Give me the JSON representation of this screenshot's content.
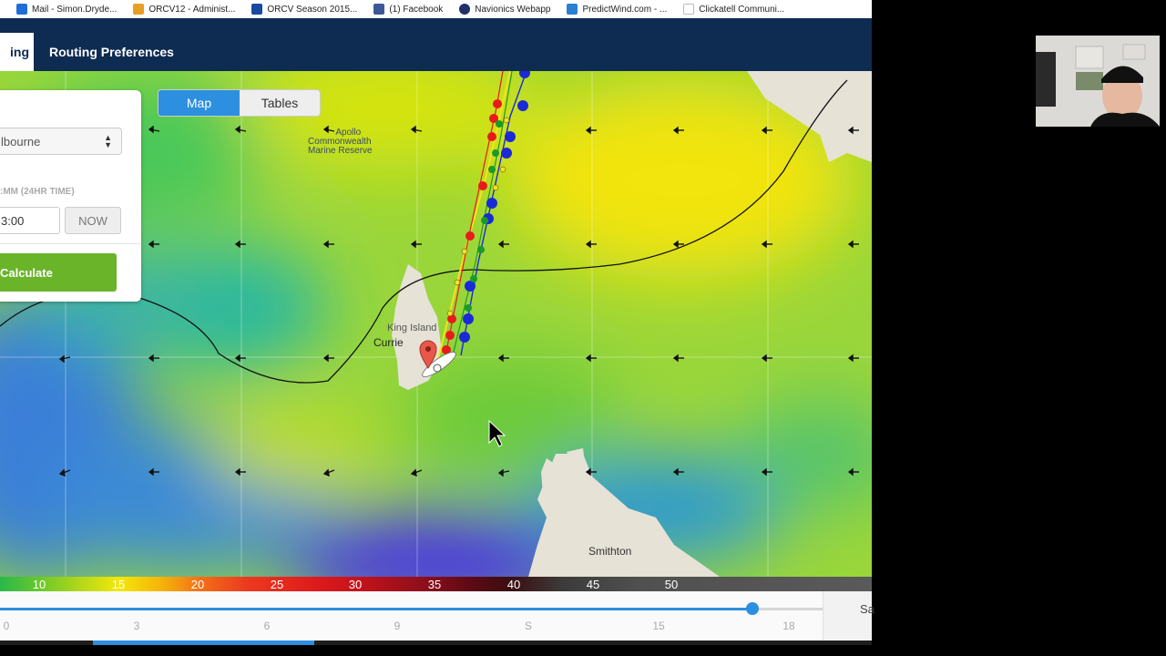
{
  "bookmarks": [
    {
      "label": "Mail - Simon.Dryde...",
      "color": "#1f6fd6"
    },
    {
      "label": "ORCV12 - Administ...",
      "color": "#e8a020"
    },
    {
      "label": "ORCV Season 2015...",
      "color": "#1a4aa0"
    },
    {
      "label": "(1) Facebook",
      "color": "#3b5998"
    },
    {
      "label": "Navionics Webapp",
      "color": "#20306a"
    },
    {
      "label": "PredictWind.com - ...",
      "color": "#2a7fd0"
    },
    {
      "label": "Clickatell Communi...",
      "color": "#e94040"
    }
  ],
  "nav": {
    "active_tab": "ing",
    "routing_preferences": "Routing Preferences"
  },
  "map_toggle": {
    "map": "Map",
    "tables": "Tables"
  },
  "panel": {
    "destination_value": "lbourne",
    "time_label": ":MM (24HR TIME)",
    "time_value": "3:00",
    "now_label": "NOW",
    "calculate_label": "Calculate"
  },
  "map_labels": {
    "reserve_line1": "Apollo",
    "reserve_line2": "Commonwealth",
    "reserve_line3": "Marine Reserve",
    "king_island": "King Island",
    "currie": "Currie",
    "smithton": "Smithton"
  },
  "scale_ticks": [
    "10",
    "15",
    "20",
    "25",
    "30",
    "35",
    "40",
    "45",
    "50"
  ],
  "timeline": {
    "ticks": [
      "0",
      "3",
      "6",
      "9",
      "S",
      "15",
      "18"
    ],
    "side_label": "Sa",
    "position": 0.915
  },
  "colors": {
    "nav_bg": "#0e2b52",
    "accent_blue": "#2c8fe0",
    "calculate_green": "#6ab42a"
  }
}
